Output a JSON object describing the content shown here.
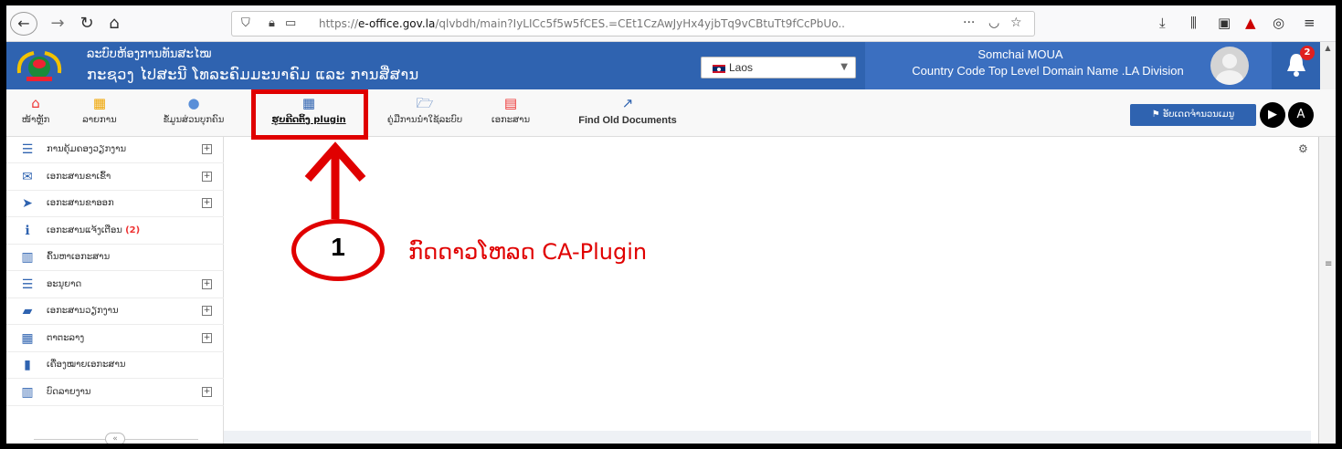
{
  "browser": {
    "url_prefix": "https://",
    "url_domain": "e-office.gov.la",
    "url_path": "/qlvbdh/main?IyLICc5f5w5fCES.=CEt1CzAwJyHx4yjbTq9vCBtuTt9fCcPbUo..",
    "more_label": "···"
  },
  "header": {
    "org_line1": "ລະບົບຫ້ອງການທັນສະໄໝ",
    "org_line2": "ກະຊວງ ໄປສະນີ ໂທລະຄົມມະນາຄົມ ແລະ ການສື່ສານ",
    "language": "Laos",
    "user_name": "Somchai MOUA",
    "user_role": "Country Code Top Level Domain Name .LA Division",
    "notification_count": "2"
  },
  "menu": {
    "home": "ໜ້າຫຼັກ",
    "list": "ລາຍການ",
    "contact": "ຂໍ້ມູນສ່ວນບຸກຄົນ",
    "plugin": "ຮູບຄີດຕິ້ງ plugin",
    "manual": "ຄູ່ມືການນຳໃຊ້ລະບົບ",
    "documents": "ເອກະສານ",
    "old_docs": "Find Old Documents",
    "update": "⚑ ອັບເດດຈຳນວນເມນູ"
  },
  "annotation": {
    "step_number": "1",
    "step_text": "ກົດດາວໂຫລດ CA-Plugin"
  },
  "sidebar": {
    "items": [
      {
        "label": "ການຄຸ້ມຄອງວຽກງານ",
        "icon": "tasks-icon",
        "glyph": "☰",
        "expand": true
      },
      {
        "label": "ເອກະສານຂາເຂົ້າ",
        "icon": "envelope-icon",
        "glyph": "✉",
        "expand": true
      },
      {
        "label": "ເອກະສານຂາອອກ",
        "icon": "send-icon",
        "glyph": "➤",
        "expand": true
      },
      {
        "label": "ເອກະສານແຈ້ງເຕືອນ",
        "count": "(2)",
        "icon": "info-icon",
        "glyph": "ℹ",
        "expand": false
      },
      {
        "label": "ຄົ້ນຫາເອກະສານ",
        "icon": "search-chart-icon",
        "glyph": "▥",
        "expand": false
      },
      {
        "label": "ອະນຸຍາດ",
        "icon": "list-icon",
        "glyph": "☰",
        "expand": true
      },
      {
        "label": "ເອກະສານວຽກງານ",
        "icon": "book-icon",
        "glyph": "▰",
        "expand": true
      },
      {
        "label": "ຕາຕະລາງ",
        "icon": "calendar-icon",
        "glyph": "▦",
        "expand": true
      },
      {
        "label": "ເຄື່ອງໝາຍເອກະສານ",
        "icon": "bookmark-icon",
        "glyph": "▮",
        "expand": false
      },
      {
        "label": "ບົດລາຍງານ",
        "icon": "report-chart-icon",
        "glyph": "▥",
        "expand": true
      }
    ],
    "collapse_glyph": "«"
  },
  "colors": {
    "header_blue": "#2f63b0",
    "annotation_red": "#e00000"
  }
}
